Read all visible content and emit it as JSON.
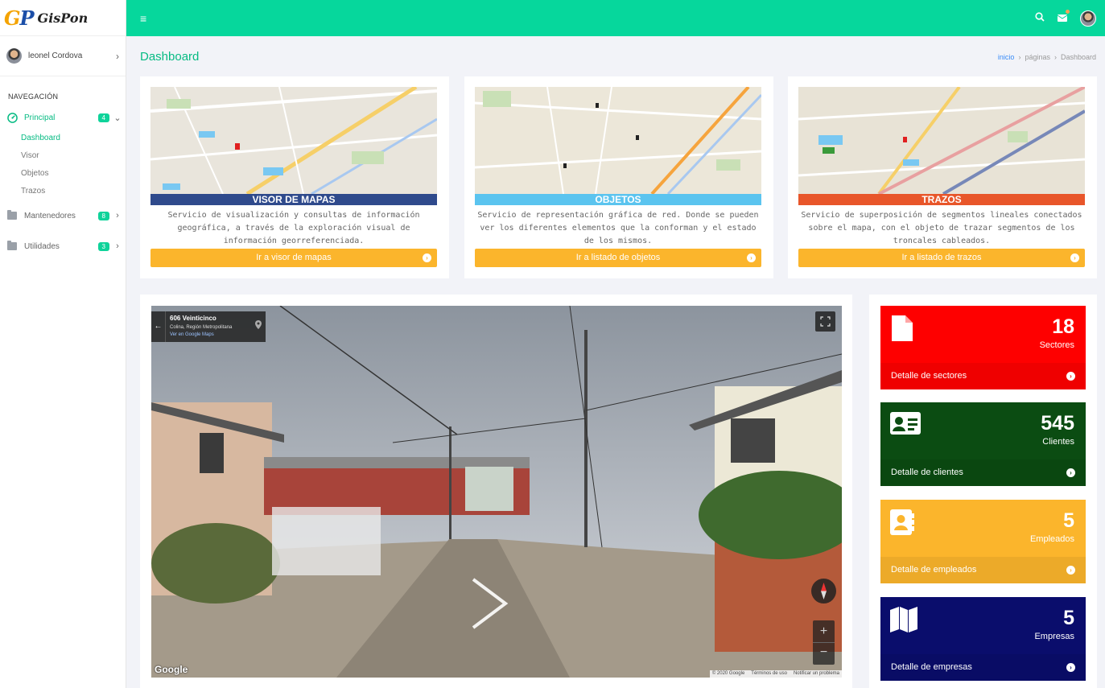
{
  "brand": {
    "logo_g": "G",
    "logo_p": "P",
    "name": "GisPon"
  },
  "user": {
    "name": "leonel Cordova"
  },
  "nav": {
    "title": "NAVEGACIÓN",
    "principal": {
      "label": "Principal",
      "badge": "4"
    },
    "subitems": [
      "Dashboard",
      "Visor",
      "Objetos",
      "Trazos"
    ],
    "mantenedores": {
      "label": "Mantenedores",
      "badge": "8"
    },
    "utilidades": {
      "label": "Utilidades",
      "badge": "3"
    }
  },
  "page": {
    "title": "Dashboard"
  },
  "breadcrumb": {
    "home": "inicio",
    "middle": "páginas",
    "current": "Dashboard"
  },
  "cards": [
    {
      "title": "VISOR DE MAPAS",
      "color": "#2f4a8c",
      "description": "Servicio de visualización y consultas de información geográfica, a través de la exploración visual de información georreferenciada.",
      "button": "Ir a visor de mapas"
    },
    {
      "title": "OBJETOS",
      "color": "#5bc4ef",
      "description": "Servicio de representación gráfica de red. Donde se pueden ver los diferentes elementos que la conforman y el estado de los mismos.",
      "button": "Ir a listado de objetos"
    },
    {
      "title": "TRAZOS",
      "color": "#e8562a",
      "description": "Servicio de superposición de segmentos lineales conectados sobre el mapa, con el objeto de trazar segmentos de los troncales cableados.",
      "button": "Ir a listado de trazos"
    }
  ],
  "streetview": {
    "address": "606 Veinticinco",
    "region": "Colina, Región Metropolitana",
    "link": "Ver en Google Maps",
    "brand": "Google",
    "footer": [
      "© 2020 Google",
      "Términos de uso",
      "Notificar un problema"
    ]
  },
  "stats": [
    {
      "number": "18",
      "label": "Sectores",
      "footer": "Detalle de sectores",
      "color": "#fe0000",
      "icon": "file-icon"
    },
    {
      "number": "545",
      "label": "Clientes",
      "footer": "Detalle de clientes",
      "color": "#0b4c12",
      "icon": "id-card-icon"
    },
    {
      "number": "5",
      "label": "Empleados",
      "footer": "Detalle de empleados",
      "color": "#fbb52c",
      "icon": "address-book-icon"
    },
    {
      "number": "5",
      "label": "Empresas",
      "footer": "Detalle de empresas",
      "color": "#0a0d6c",
      "icon": "map-icon"
    }
  ]
}
